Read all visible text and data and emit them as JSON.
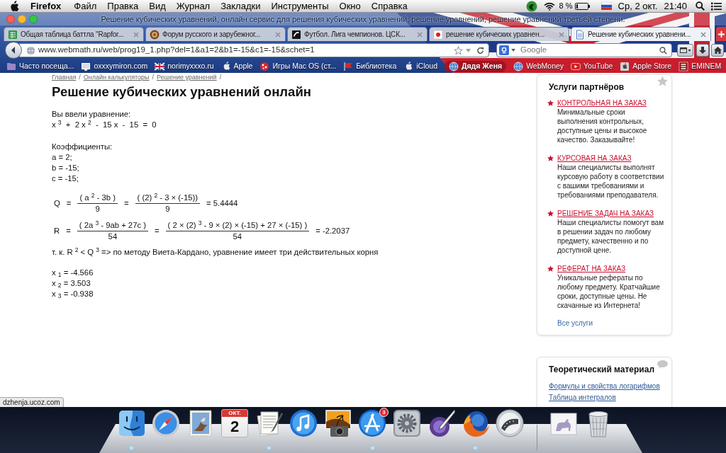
{
  "menu_bar": {
    "app_name": "Firefox",
    "menus": [
      "Файл",
      "Правка",
      "Вид",
      "Журнал",
      "Закладки",
      "Инструменты",
      "Окно",
      "Справка"
    ],
    "battery": "8 %",
    "date": "Ср, 2 окт.",
    "time": "21:40"
  },
  "window": {
    "title": "Решение кубических уравнений, онлайн сервис для решения кубических уравнений, решение уравнений, решение уравнений третьей степени."
  },
  "tabs": [
    {
      "kind": "sheet",
      "label": "Общая таблица баттла \"Rapfor...",
      "selected": false
    },
    {
      "kind": "round",
      "label": "Форум русского и зарубежног...",
      "selected": false
    },
    {
      "kind": "dark",
      "label": "Футбол. Лига чемпионов. ЦСК...",
      "selected": false
    },
    {
      "kind": "light",
      "label": "решение кубических уравнен...",
      "selected": false
    },
    {
      "kind": "page",
      "label": "Решение кубических уравнени...",
      "selected": true
    }
  ],
  "toolbar": {
    "url": "www.webmath.ru/web/prog19_1.php?del=1&a1=2&b1=-15&c1=-15&schet=1",
    "search_placeholder": "Google"
  },
  "bookmarks": [
    {
      "kind": "folder",
      "label": "Часто посеща...",
      "selected": false
    },
    {
      "kind": "page",
      "label": "oxxxymiron.com",
      "selected": false
    },
    {
      "kind": "flag",
      "label": "norimyxxxo.ru",
      "selected": false
    },
    {
      "kind": "apple",
      "label": "Apple",
      "selected": false
    },
    {
      "kind": "spots",
      "label": "Игры Mac OS (ст...",
      "selected": false
    },
    {
      "kind": "pennant",
      "label": "Библиотека",
      "selected": false
    },
    {
      "kind": "apple",
      "label": "iCloud",
      "selected": false
    },
    {
      "kind": "globe",
      "label": "Дядя Женя",
      "selected": true
    },
    {
      "kind": "globe",
      "label": "WebMoney",
      "selected": false
    },
    {
      "kind": "play",
      "label": "YouTube",
      "selected": false
    },
    {
      "kind": "tile",
      "label": "Apple Store",
      "selected": false
    },
    {
      "kind": "square",
      "label": "EMINEM",
      "selected": false
    }
  ],
  "breadcrumb": {
    "items": [
      "Главная",
      "Онлайн калькуляторы",
      "Решение уравнений"
    ],
    "separator": "/"
  },
  "article": {
    "title": "Решение кубических уравнений онлайн",
    "input_label": "Вы ввели уравнение:",
    "equation": "x $^{3}$  +  2 x $^{2}$  -  15 x  -  15  =  0",
    "coefficients_label": "Коэффициенты:",
    "coefficients": [
      "a = 2;",
      "b = -15;",
      "c = -15;"
    ],
    "formulas": [
      [
        {
          "kind": "text",
          "text": "Q"
        },
        {
          "kind": "text",
          "text": "="
        },
        {
          "kind": "fraction",
          "numerator": "( a $^{2}$ - 3b )",
          "denominator": "9"
        },
        {
          "kind": "text",
          "text": "="
        },
        {
          "kind": "fraction",
          "numerator": "( (2) $^{2}$ - 3 × (-15))",
          "denominator": "9"
        },
        {
          "kind": "text",
          "text": "= 5.4444"
        }
      ],
      [
        {
          "kind": "text",
          "text": "R"
        },
        {
          "kind": "text",
          "text": "="
        },
        {
          "kind": "fraction",
          "numerator": "( 2a $^{3}$ - 9ab + 27c )",
          "denominator": "54"
        },
        {
          "kind": "text",
          "text": "="
        },
        {
          "kind": "fraction",
          "numerator": "( 2 × (2) $^{3}$ - 9 × (2) × (-15) + 27 × (-15) )",
          "denominator": "54"
        },
        {
          "kind": "text",
          "text": "= -2.2037"
        }
      ]
    ],
    "conclusion": "т. к. R $^{2}$ < Q $^{3}$ => по методу Виета-Кардано, уравнение имеет три действительных корня",
    "roots": [
      "x $_{1}$ = -4.566",
      "x $_{2}$ = 3.503",
      "x $_{3}$ = -0.938"
    ]
  },
  "sidebar": [
    {
      "kind": "services",
      "title": "Услуги партнёров",
      "items": [
        {
          "link": "КОНТРОЛЬНАЯ НА ЗАКАЗ",
          "text": "Минимальные сроки выполнения контрольных, доступные цены и высокое качество. Заказывайте!"
        },
        {
          "link": "КУРСОВАЯ НА ЗАКАЗ",
          "text": "Наши специалисты выполнят курсовую работу в соответствии с вашими требованиями и требованиями преподавателя."
        },
        {
          "link": "РЕШЕНИЕ ЗАДАЧ НА ЗАКАЗ",
          "text": "Наши специалисты помогут вам в решении задач по любому предмету, качественно и по доступной цене."
        },
        {
          "link": "РЕФЕРАТ НА ЗАКАЗ",
          "text": "Уникальные рефераты по любому предмету. Кратчайшие сроки, доступные цены. Не скачанные из Интернета!"
        }
      ],
      "more": "Все услуги"
    },
    {
      "kind": "theory",
      "title": "Теоретический материал",
      "links": [
        "Формулы и свойства логарифмов",
        "Таблица интегралов"
      ]
    }
  ],
  "status_url": "dzhenja.ucoz.com",
  "dock": {
    "apps": [
      {
        "kind": "face",
        "running": true
      },
      {
        "kind": "compass",
        "running": false
      },
      {
        "kind": "stamp",
        "running": false
      },
      {
        "kind": "calendar",
        "month": "ОКТ.",
        "day": "2",
        "running": false
      },
      {
        "kind": "notepad",
        "running": true
      },
      {
        "kind": "music",
        "running": false
      },
      {
        "kind": "photo",
        "running": false
      },
      {
        "kind": "store",
        "badge": "3",
        "running": true
      },
      {
        "kind": "gear",
        "running": false
      },
      {
        "kind": "ink",
        "running": false
      },
      {
        "kind": "fox",
        "running": true
      },
      {
        "kind": "film",
        "running": false
      }
    ],
    "stacks": [
      {
        "kind": "stack",
        "running": false
      },
      {
        "kind": "trash",
        "running": false
      }
    ]
  }
}
